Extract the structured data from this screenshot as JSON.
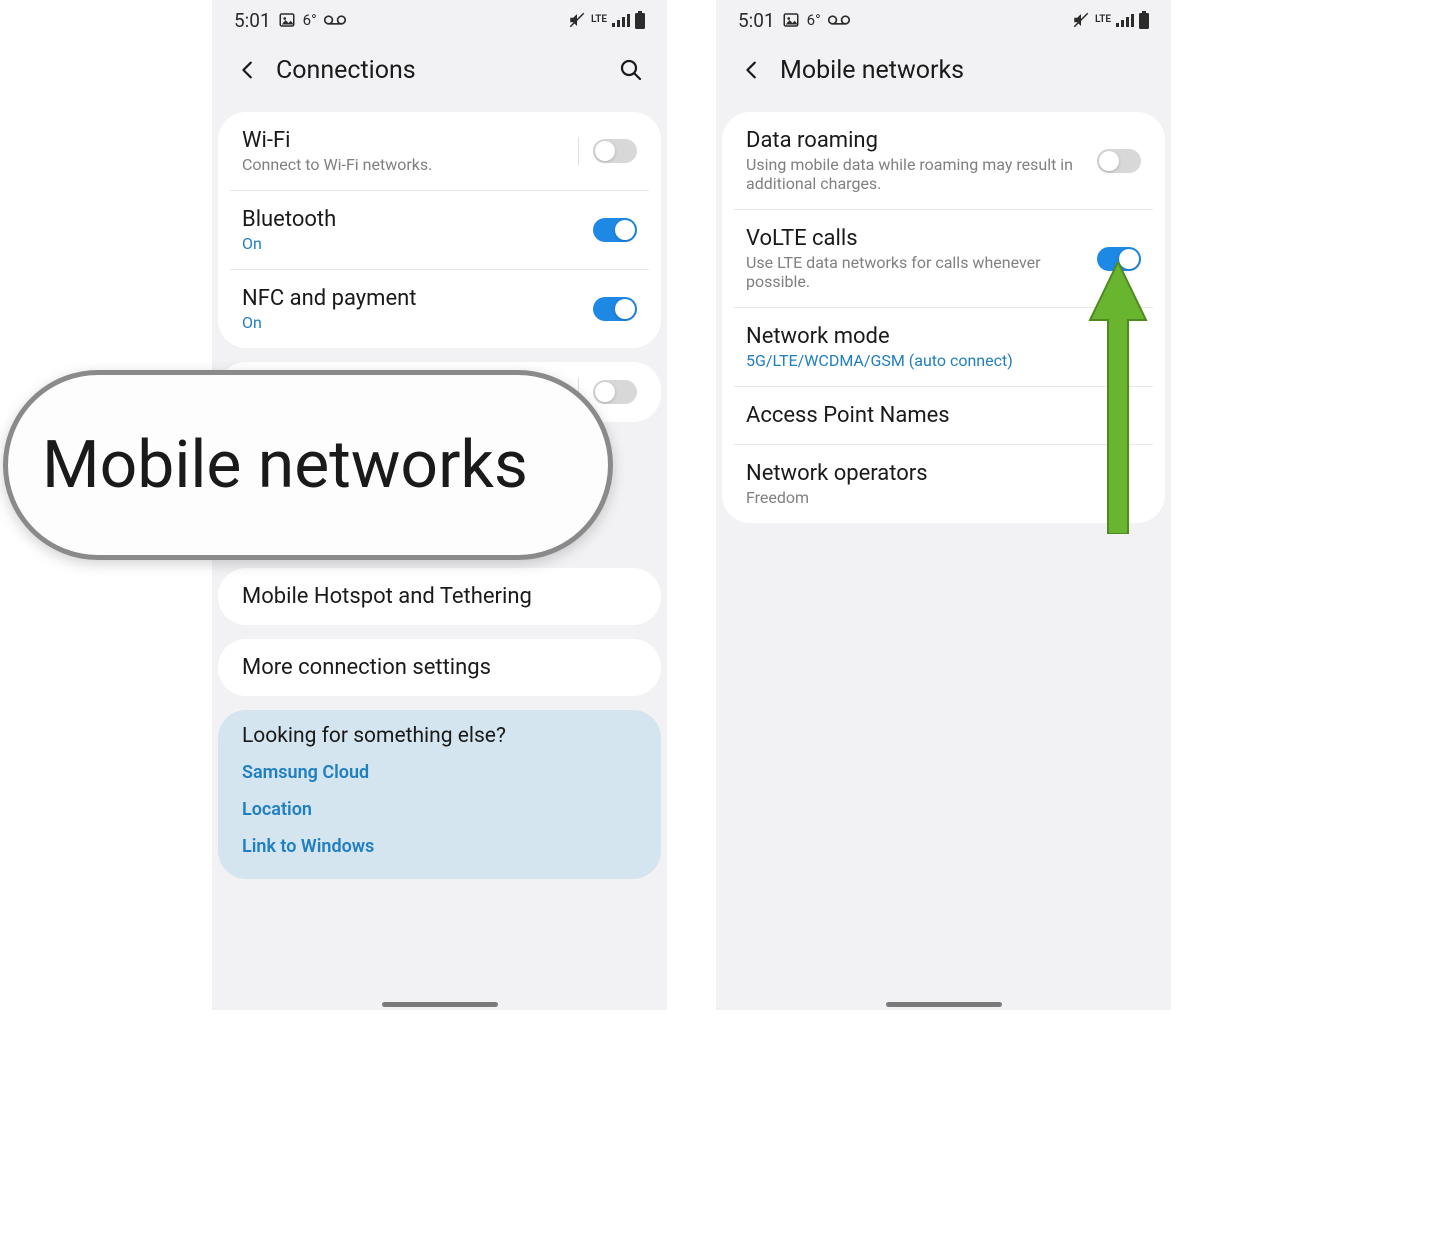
{
  "status": {
    "time": "5:01",
    "temp": "6°",
    "net_label": "LTE"
  },
  "left": {
    "title": "Connections",
    "rows": {
      "wifi": {
        "title": "Wi-Fi",
        "sub": "Connect to Wi-Fi networks."
      },
      "bt": {
        "title": "Bluetooth",
        "sub": "On"
      },
      "nfc": {
        "title": "NFC and payment",
        "sub": "On"
      },
      "hotspot": {
        "title": "Mobile Hotspot and Tethering"
      },
      "more": {
        "title": "More connection settings"
      }
    },
    "else": {
      "title": "Looking for something else?",
      "links": [
        "Samsung Cloud",
        "Location",
        "Link to Windows"
      ]
    }
  },
  "right": {
    "title": "Mobile networks",
    "rows": {
      "roam": {
        "title": "Data roaming",
        "sub": "Using mobile data while roaming may result in additional charges."
      },
      "volte": {
        "title": "VoLTE calls",
        "sub": "Use LTE data networks for calls whenever possible."
      },
      "mode": {
        "title": "Network mode",
        "sub": "5G/LTE/WCDMA/GSM (auto connect)"
      },
      "apn": {
        "title": "Access Point Names"
      },
      "op": {
        "title": "Network operators",
        "sub": "Freedom"
      }
    }
  },
  "callout": "Mobile networks"
}
